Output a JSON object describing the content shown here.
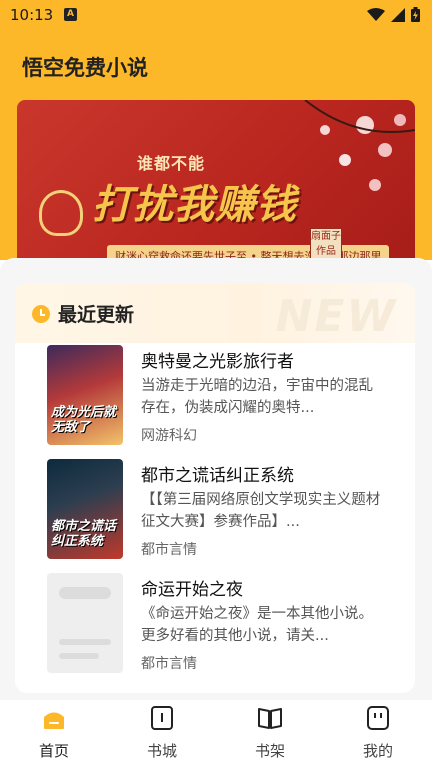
{
  "status_bar": {
    "time": "10:13",
    "notif": "A"
  },
  "header": {
    "title": "悟空免费小说"
  },
  "banner": {
    "small_title": "谁都不能",
    "big_title": "打扰我赚钱",
    "tagline": "财迷心窍救命还要先世子至 • 整天想去洗江湖那边那里",
    "stamp": "扇面子作品"
  },
  "recent": {
    "title": "最近更新",
    "watermark": "NEW",
    "books": [
      {
        "title": "奥特曼之光影旅行者",
        "desc": "当游走于光暗的边沿，宇宙中的混乱存在，伪装成闪耀的奥特...",
        "genre": "网游科幻",
        "cover_text": "成为光后就无敌了"
      },
      {
        "title": "都市之谎话纠正系统",
        "desc": "【【第三届网络原创文学现实主义题材征文大赛】参赛作品】...",
        "genre": "都市言情",
        "cover_text": "都市之谎话纠正系统"
      },
      {
        "title": "命运开始之夜",
        "desc": "《命运开始之夜》是一本其他小说。更多好看的其他小说，请关...",
        "genre": "都市言情"
      }
    ]
  },
  "tabs": [
    {
      "label": "首页",
      "icon": "home-icon",
      "active": true
    },
    {
      "label": "书城",
      "icon": "store-icon",
      "active": false
    },
    {
      "label": "书架",
      "icon": "bookshelf-icon",
      "active": false
    },
    {
      "label": "我的",
      "icon": "profile-icon",
      "active": false
    }
  ],
  "colors": {
    "accent": "#FDB829",
    "text": "#222222"
  }
}
